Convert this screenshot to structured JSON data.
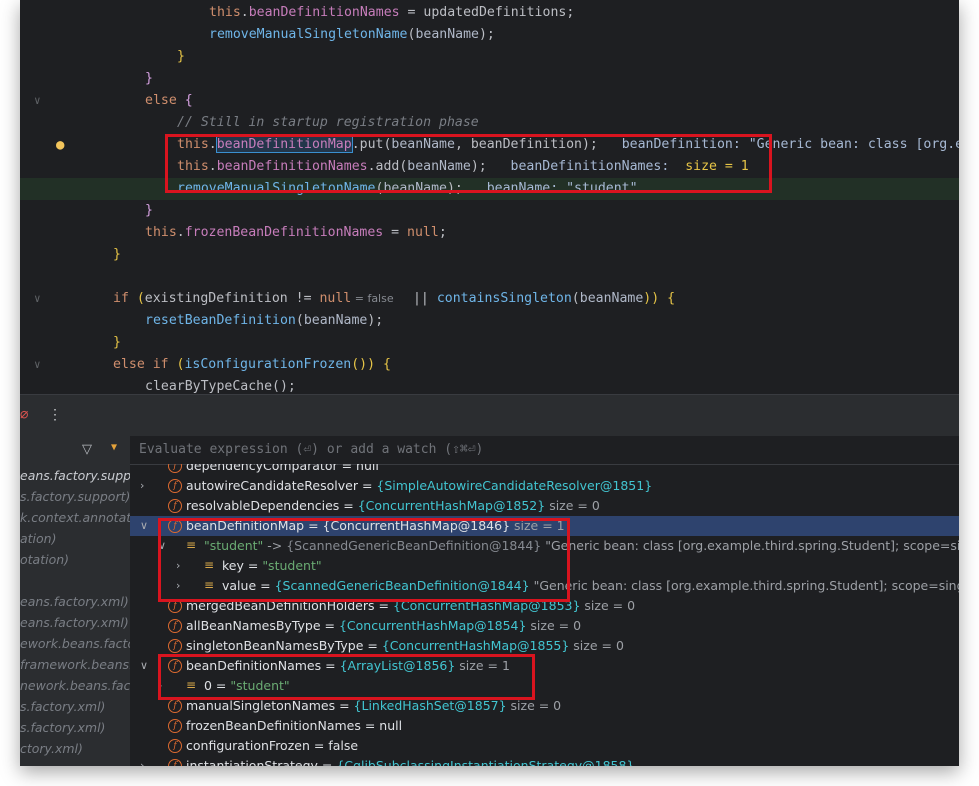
{
  "editor": {
    "lines": [
      {
        "segments": [
          [
            "this",
            "kw"
          ],
          [
            ".",
            "var"
          ],
          [
            "beanDefinitionNames",
            "fld"
          ],
          [
            " = ",
            "var"
          ],
          [
            "updatedDefinitions",
            "var"
          ],
          [
            ";",
            "var"
          ]
        ]
      },
      {
        "segments": [
          [
            "removeManualSingletonName",
            "call"
          ],
          [
            "(",
            "var"
          ],
          [
            "beanName",
            "param"
          ],
          [
            ");",
            "var"
          ]
        ]
      },
      {
        "segments": [
          [
            "}",
            "brace"
          ]
        ]
      },
      {
        "segments": [
          [
            "}",
            "brace2"
          ]
        ]
      },
      {
        "segments": [
          [
            "else",
            "kw"
          ],
          [
            " {",
            "brace2"
          ]
        ]
      },
      {
        "segments": [
          [
            "// Still in startup registration phase",
            "cmt"
          ]
        ]
      },
      {
        "segments": [
          [
            "this",
            "kw"
          ],
          [
            ".",
            "var"
          ],
          [
            "beanDefinitionMap",
            "sel"
          ],
          [
            ".put(",
            "var"
          ],
          [
            "beanName",
            "param"
          ],
          [
            ", ",
            "var"
          ],
          [
            "beanDefinition",
            "vbl"
          ],
          [
            ");",
            "var"
          ],
          [
            "   beanDefinition: \"Generic bean: class [org.e",
            "hint2"
          ]
        ]
      },
      {
        "segments": [
          [
            "this",
            "kw"
          ],
          [
            ".",
            "var"
          ],
          [
            "beanDefinitionNames",
            "fld"
          ],
          [
            ".add(",
            "var"
          ],
          [
            "beanName",
            "param"
          ],
          [
            ");",
            "var"
          ],
          [
            "   beanDefinitionNames:  ",
            "hint2"
          ],
          [
            "size = 1",
            "brace"
          ]
        ]
      },
      {
        "segments": [
          [
            "removeManualSingletonName",
            "call"
          ],
          [
            "(",
            "var"
          ],
          [
            "beanName",
            "param"
          ],
          [
            ");",
            "var"
          ],
          [
            "   beanName: \"student\"",
            "hint2"
          ]
        ]
      },
      {
        "segments": [
          [
            "}",
            "brace2"
          ]
        ]
      },
      {
        "segments": [
          [
            "this",
            "kw"
          ],
          [
            ".",
            "var"
          ],
          [
            "frozenBeanDefinitionNames",
            "fld"
          ],
          [
            " = ",
            "var"
          ],
          [
            "null",
            "kw"
          ],
          [
            ";",
            "var"
          ]
        ]
      },
      {
        "segments": [
          [
            "}",
            "brace"
          ]
        ]
      },
      {
        "segments": []
      },
      {
        "segments": [
          [
            "if",
            "kw"
          ],
          [
            " (",
            "brace"
          ],
          [
            "existingDefinition",
            "vbl"
          ],
          [
            " != ",
            "var"
          ],
          [
            "null",
            "kw"
          ],
          [
            " = false ",
            "small"
          ],
          [
            "  || ",
            "var"
          ],
          [
            "containsSingleton",
            "call"
          ],
          [
            "(",
            "var"
          ],
          [
            "beanName",
            "param"
          ],
          [
            ")) {",
            "brace"
          ]
        ]
      },
      {
        "segments": [
          [
            "resetBeanDefinition",
            "call"
          ],
          [
            "(",
            "var"
          ],
          [
            "beanName",
            "param"
          ],
          [
            ");",
            "var"
          ]
        ]
      },
      {
        "segments": [
          [
            "}",
            "brace"
          ]
        ]
      },
      {
        "segments": [
          [
            "else if",
            "kw"
          ],
          [
            " (",
            "brace"
          ],
          [
            "isConfigurationFrozen",
            "call"
          ],
          [
            "()) {",
            "brace"
          ]
        ]
      },
      {
        "segments": [
          [
            "clearByTypeCache();",
            "var"
          ]
        ]
      }
    ]
  },
  "debug": {
    "eval_placeholder": "Evaluate expression (⏎) or add a watch (⇧⌘⏎)",
    "frames": [
      "eans.factory.suppor",
      "s.factory.support)",
      "k.context.annotatio",
      "ation)",
      "otation)",
      "",
      "eans.factory.xml)",
      "eans.factory.xml)",
      "ework.beans.facto",
      "framework.beans.",
      "nework.beans.fact",
      "s.factory.xml)",
      "s.factory.xml)",
      "ctory.xml)"
    ],
    "vars": [
      {
        "name": "dependencyComparator",
        "eq": " = ",
        "val": "null",
        "valcls": "vwhite",
        "extra": ""
      },
      {
        "name": "autowireCandidateResolver",
        "eq": " = ",
        "val": "{SimpleAutowireCandidateResolver@1851}",
        "valcls": "vval",
        "extra": ""
      },
      {
        "name": "resolvableDependencies",
        "eq": " = ",
        "val": "{ConcurrentHashMap@1852}",
        "valcls": "vval",
        "extra": "  size = 0"
      },
      {
        "name": "beanDefinitionMap",
        "eq": " = ",
        "val": "{ConcurrentHashMap@1846}",
        "valcls": "vwhite",
        "extra": "  size = 1"
      },
      {
        "name": "\"student\"",
        "eq": " -> ",
        "val": "{ScannedGenericBeanDefinition@1844}",
        "valcls": "vdim",
        "extra": " \"Generic bean: class [org.example.third.spring.Student]; scope=singl"
      },
      {
        "name": "key",
        "eq": " = ",
        "val": "\"student\"",
        "valcls": "vstr",
        "extra": ""
      },
      {
        "name": "value",
        "eq": " = ",
        "val": "{ScannedGenericBeanDefinition@1844}",
        "valcls": "vval",
        "extra": " \"Generic bean: class [org.example.third.spring.Student]; scope=singlet"
      },
      {
        "name": "mergedBeanDefinitionHolders",
        "eq": " = ",
        "val": "{ConcurrentHashMap@1853}",
        "valcls": "vval",
        "extra": "  size = 0"
      },
      {
        "name": "allBeanNamesByType",
        "eq": " = ",
        "val": "{ConcurrentHashMap@1854}",
        "valcls": "vval",
        "extra": "  size = 0"
      },
      {
        "name": "singletonBeanNamesByType",
        "eq": " = ",
        "val": "{ConcurrentHashMap@1855}",
        "valcls": "vval",
        "extra": "  size = 0"
      },
      {
        "name": "beanDefinitionNames",
        "eq": " = ",
        "val": "{ArrayList@1856}",
        "valcls": "vval",
        "extra": "  size = 1"
      },
      {
        "name": "0",
        "eq": " = ",
        "val": "\"student\"",
        "valcls": "vstr",
        "extra": ""
      },
      {
        "name": "manualSingletonNames",
        "eq": " = ",
        "val": "{LinkedHashSet@1857}",
        "valcls": "vval",
        "extra": "  size = 0"
      },
      {
        "name": "frozenBeanDefinitionNames",
        "eq": " = ",
        "val": "null",
        "valcls": "vwhite",
        "extra": ""
      },
      {
        "name": "configurationFrozen",
        "eq": " = ",
        "val": "false",
        "valcls": "vwhite",
        "extra": ""
      },
      {
        "name": "instantiationStrategy",
        "eq": " = ",
        "val": "{CglibSubclassingInstantiationStrategy@1858}",
        "valcls": "vval",
        "extra": ""
      }
    ]
  }
}
